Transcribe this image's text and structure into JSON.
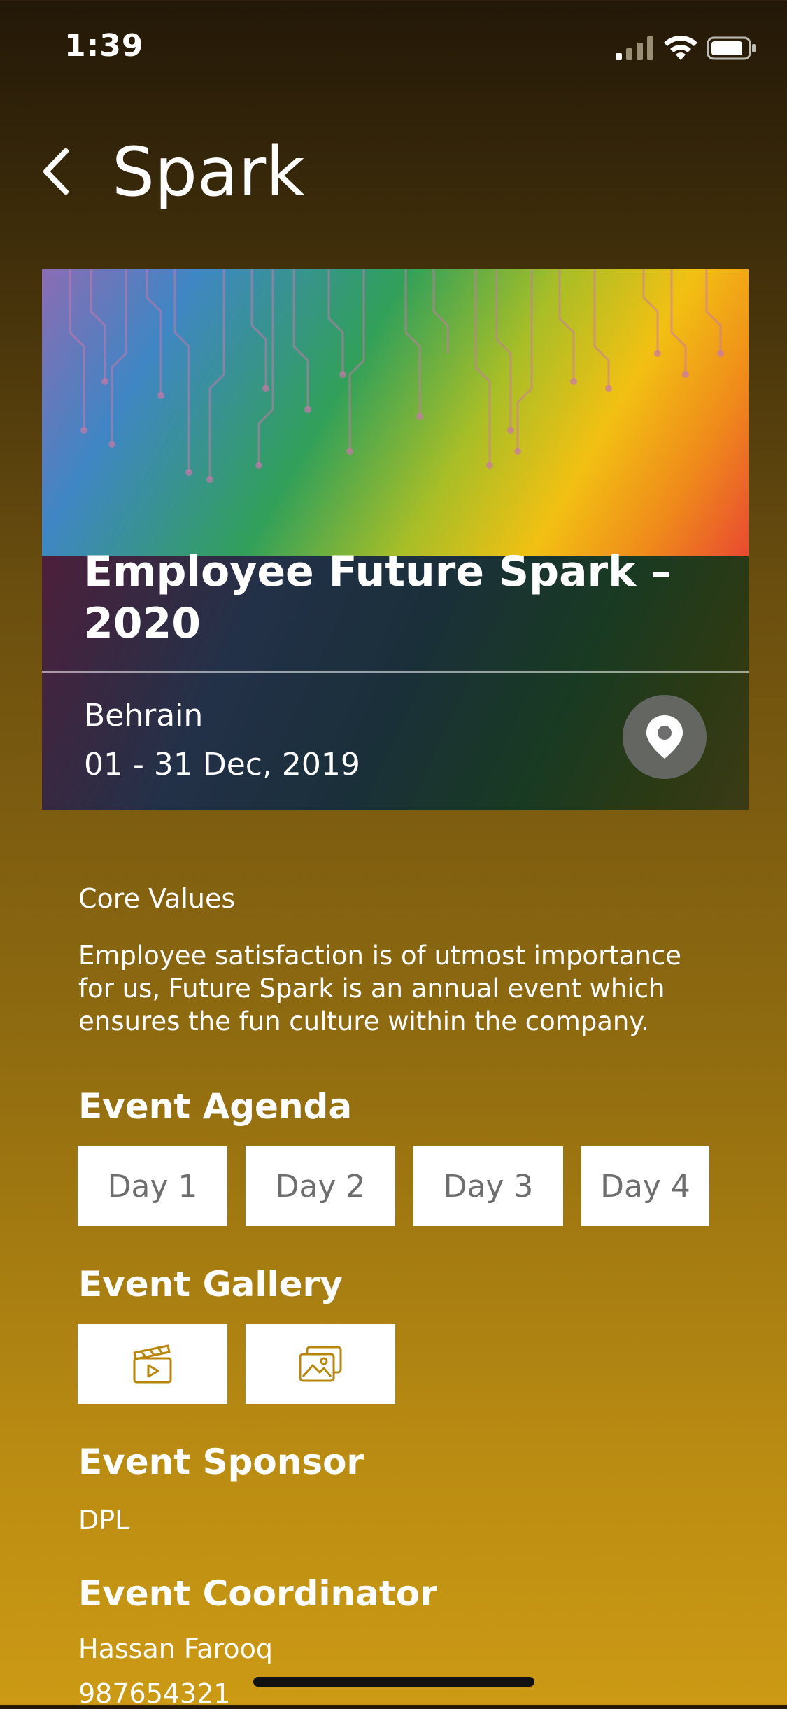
{
  "status": {
    "time": "1:39"
  },
  "header": {
    "title": "Spark"
  },
  "event": {
    "title": "Employee Future Spark – 2020",
    "location": "Behrain",
    "date": "01 - 31 Dec, 2019"
  },
  "core_values": {
    "label": "Core Values",
    "text": "Employee satisfaction is of utmost importance for us, Future Spark is an annual event which ensures the fun culture within the company."
  },
  "agenda": {
    "heading": "Event Agenda",
    "days": [
      "Day 1",
      "Day 2",
      "Day 3",
      "Day 4"
    ]
  },
  "gallery": {
    "heading": "Event Gallery",
    "items": [
      {
        "icon": "video-clapper-icon"
      },
      {
        "icon": "photos-icon"
      }
    ]
  },
  "sponsor": {
    "heading": "Event Sponsor",
    "value": "DPL"
  },
  "coordinator": {
    "heading": "Event Coordinator",
    "name": "Hassan Farooq",
    "phone": "987654321"
  },
  "colors": {
    "accent": "#B8860B",
    "button_bg": "#FFFFFF",
    "button_text": "#6E6E6E"
  }
}
